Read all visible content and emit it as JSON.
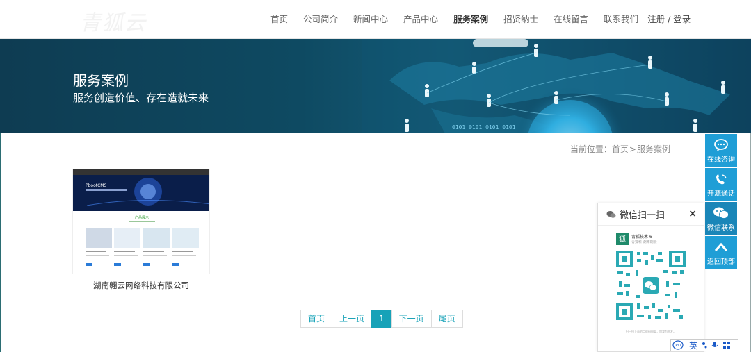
{
  "header": {
    "logo": "青狐云",
    "nav": [
      "首页",
      "公司简介",
      "新闻中心",
      "产品中心",
      "服务案例",
      "招贤纳士",
      "在线留言",
      "联系我们"
    ],
    "active_index": 4,
    "login": "注册 / 登录"
  },
  "banner": {
    "title": "服务案例",
    "subtitle": "服务创造价值、存在造就未来"
  },
  "breadcrumb": {
    "prefix": "当前位置：",
    "home": "首页",
    "separator": ">",
    "current": "服务案例"
  },
  "cases": [
    {
      "title": "湖南翱云网络科技有限公司",
      "thumb_brand": "PbootCMS",
      "thumb_section": "产品展示"
    }
  ],
  "pagination": {
    "first": "首页",
    "prev": "上一页",
    "current": "1",
    "next": "下一页",
    "last": "尾页"
  },
  "sidebar": [
    {
      "label": "在线咨询",
      "icon": "chat-bubble-icon"
    },
    {
      "label": "开源通话",
      "icon": "phone-icon"
    },
    {
      "label": "微信联系",
      "icon": "wechat-icon"
    },
    {
      "label": "返回顶部",
      "icon": "chevron-up-icon"
    }
  ],
  "wechat_popup": {
    "title": "微信扫一扫",
    "close": "×",
    "account_name": "青狐技术 6",
    "account_sub": "青狐科 湖南翱云",
    "footer": "扫一扫上面的二维码图案，加我为朋友。"
  },
  "ime": {
    "mode": "英"
  },
  "colors": {
    "accent": "#17a2b8",
    "sidebar": "#1f9ed6",
    "banner_dark": "#0e3c52"
  }
}
